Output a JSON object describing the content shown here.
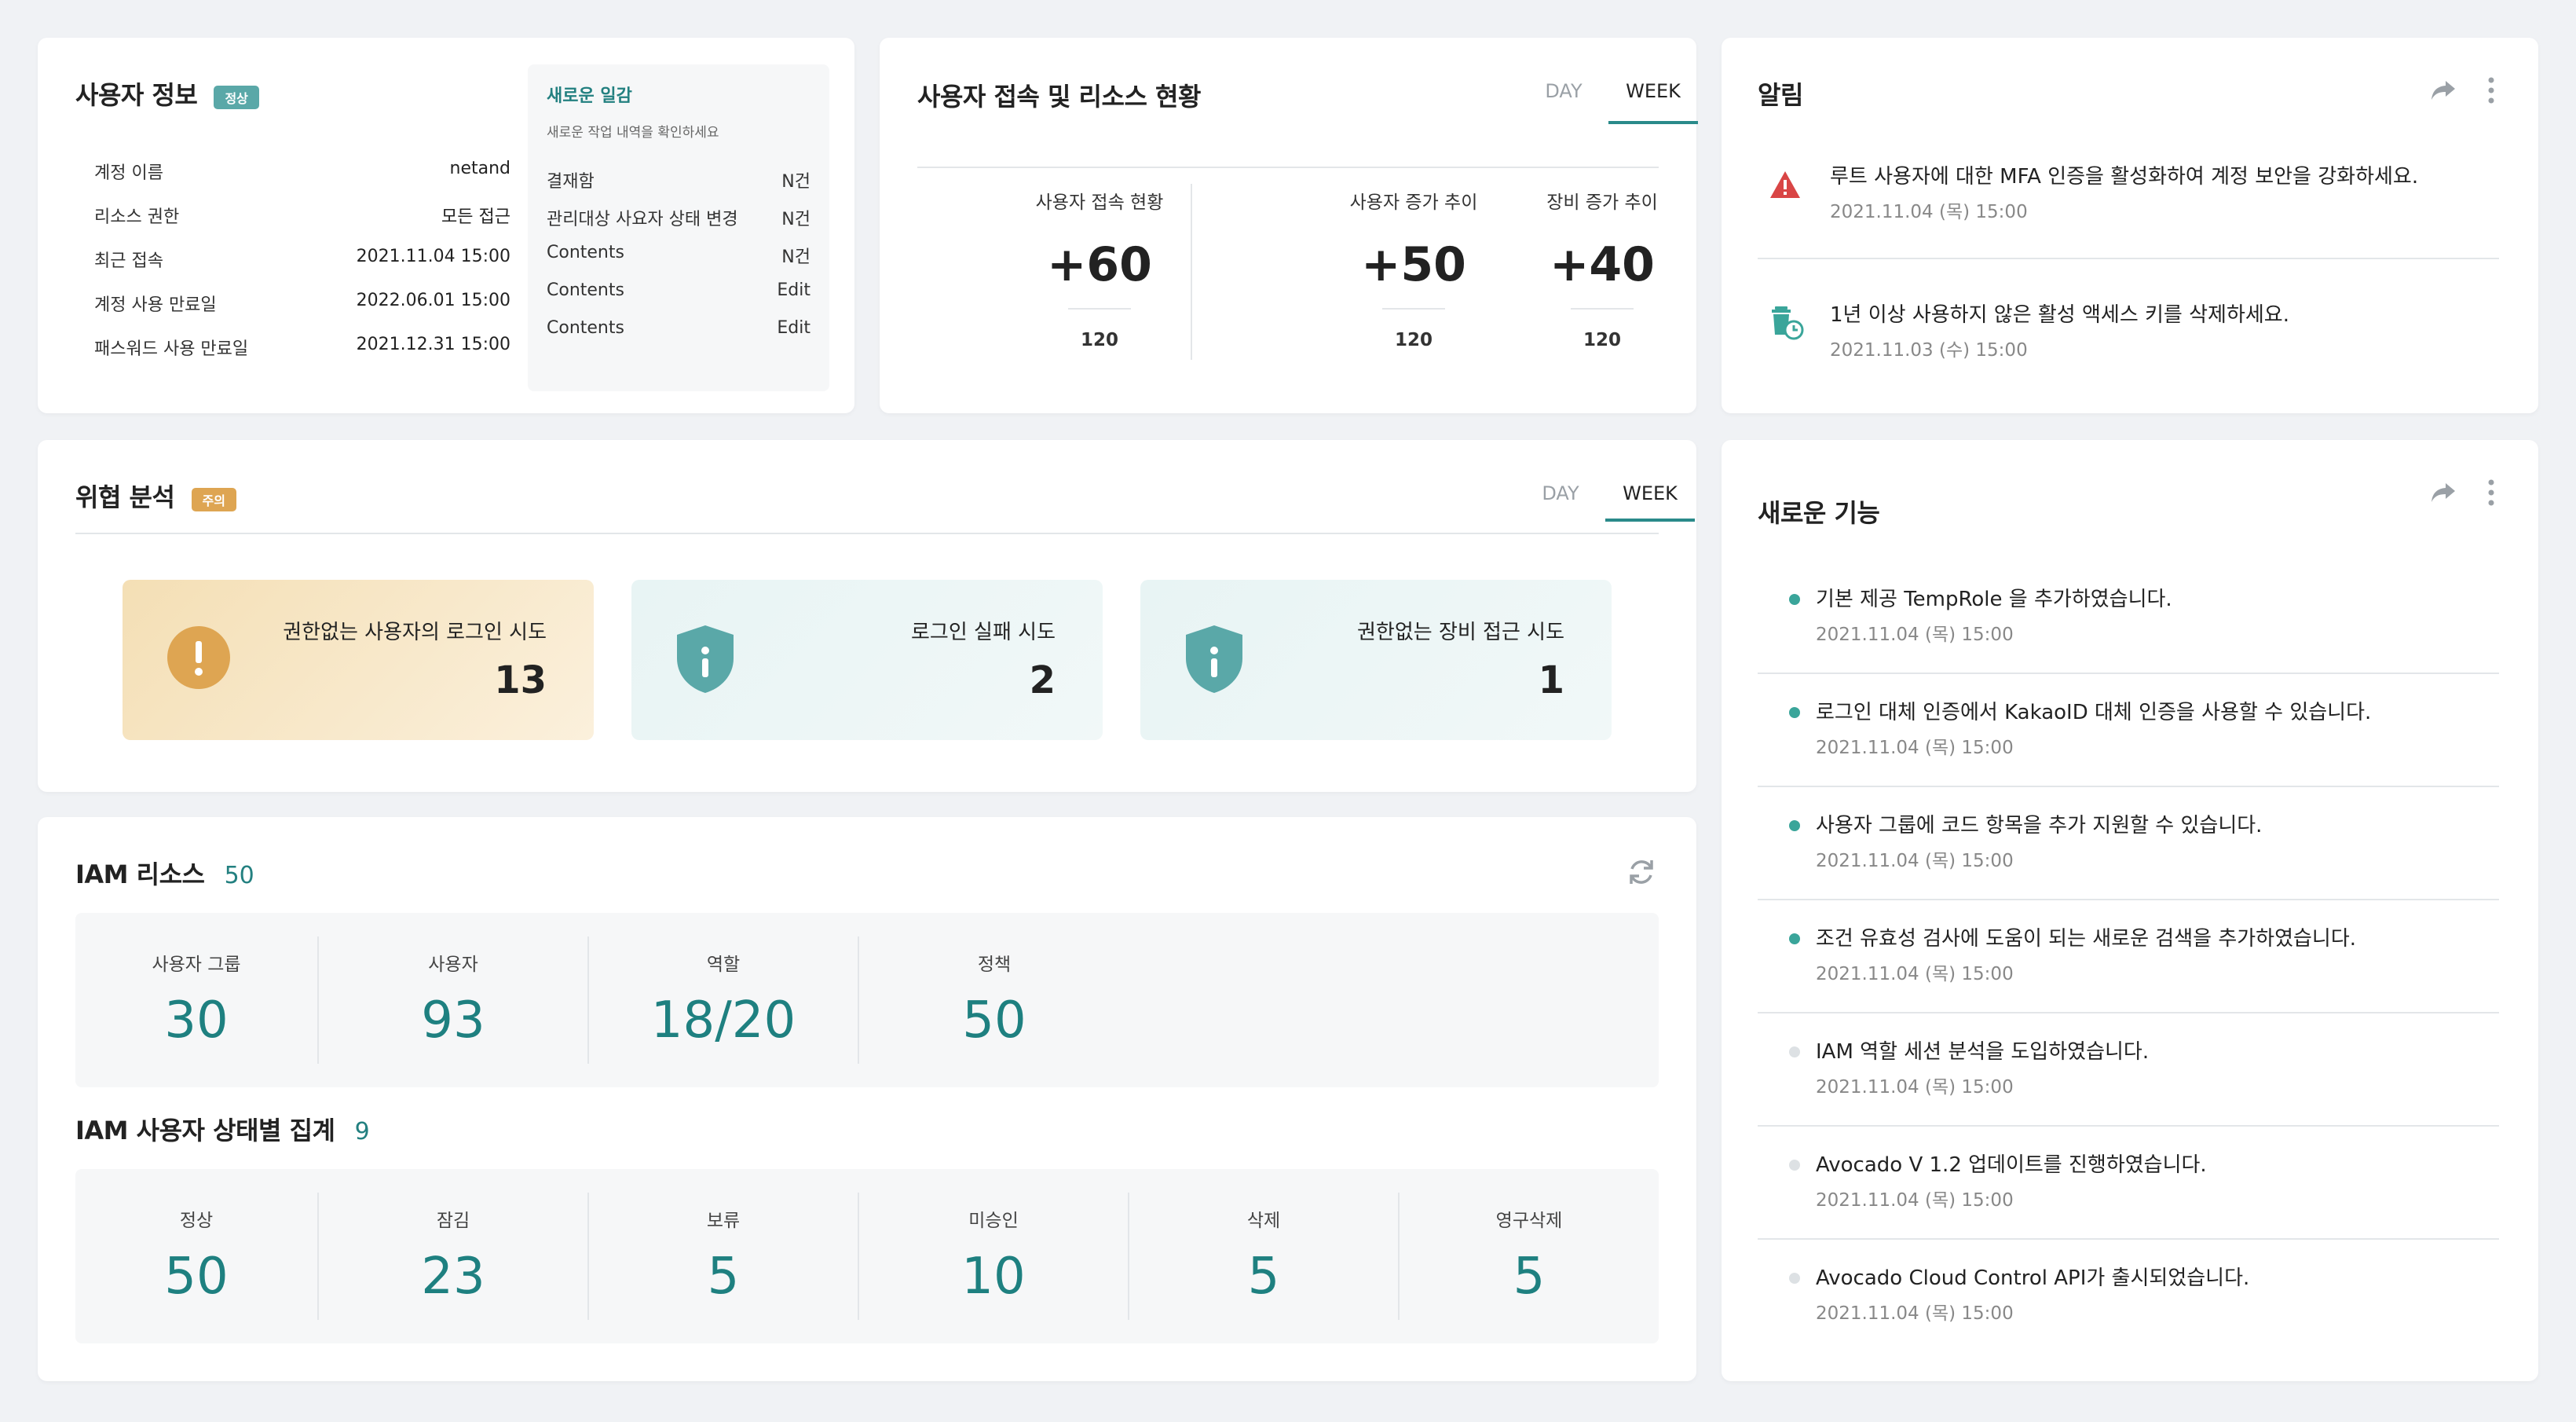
{
  "user_info": {
    "title": "사용자 정보",
    "badge": "정상",
    "rows": [
      {
        "label": "계정 이름",
        "value": "netand"
      },
      {
        "label": "리소스 권한",
        "value": "모든 접근"
      },
      {
        "label": "최근 접속",
        "value": "2021.11.04 15:00"
      },
      {
        "label": "계정 사용 만료일",
        "value": "2022.06.01 15:00"
      },
      {
        "label": "패스워드 사용 만료일",
        "value": "2021.12.31 15:00"
      }
    ],
    "recent": {
      "title": "새로운 일감",
      "subtitle": "새로운 작업 내역을 확인하세요",
      "rows": [
        {
          "label": "결재함",
          "value": "N건"
        },
        {
          "label": "관리대상 사요자 상태 변경",
          "value": "N건"
        },
        {
          "label": "Contents",
          "value": "N건"
        },
        {
          "label": "Contents",
          "value": "Edit"
        },
        {
          "label": "Contents",
          "value": "Edit"
        }
      ]
    }
  },
  "access": {
    "title": "사용자 접속 및 리소스 현황",
    "tabs": [
      "DAY",
      "WEEK"
    ],
    "active_tab": "WEEK",
    "stats": [
      {
        "label": "사용자 접속 현황",
        "value": "+60",
        "sub": "120"
      },
      {
        "label": "사용자 증가 추이",
        "value": "+50",
        "sub": "120"
      },
      {
        "label": "장비 증가 추이",
        "value": "+40",
        "sub": "120"
      }
    ]
  },
  "alerts": {
    "title": "알림",
    "items": [
      {
        "text": "루트 사용자에 대한 MFA 인증을 활성화하여 계정 보안을 강화하세요.",
        "date": "2021.11.04 (목) 15:00",
        "icon": "warning-triangle-icon"
      },
      {
        "text": "1년 이상 사용하지 않은 활성 액세스 키를 삭제하세요.",
        "date": "2021.11.03 (수) 15:00",
        "icon": "trash-clock-icon"
      }
    ]
  },
  "threat": {
    "title": "위협 분석",
    "badge": "주의",
    "tabs": [
      "DAY",
      "WEEK"
    ],
    "active_tab": "WEEK",
    "cards": [
      {
        "label": "권한없는 사용자의 로그인 시도",
        "value": "13",
        "icon": "exclamation-circle-icon"
      },
      {
        "label": "로그인 실패 시도",
        "value": "2",
        "icon": "shield-info-icon"
      },
      {
        "label": "권한없는 장비 접근 시도",
        "value": "1",
        "icon": "shield-info-icon"
      }
    ]
  },
  "iam_resource": {
    "title": "IAM 리소스",
    "count": "50",
    "items": [
      {
        "label": "사용자 그룹",
        "value": "30"
      },
      {
        "label": "사용자",
        "value": "93"
      },
      {
        "label": "역할",
        "value": "18/20"
      },
      {
        "label": "정책",
        "value": "50"
      }
    ]
  },
  "iam_status": {
    "title": "IAM 사용자 상태별 집계",
    "count": "9",
    "items": [
      {
        "label": "정상",
        "value": "50"
      },
      {
        "label": "잠김",
        "value": "23"
      },
      {
        "label": "보류",
        "value": "5"
      },
      {
        "label": "미승인",
        "value": "10"
      },
      {
        "label": "삭제",
        "value": "5"
      },
      {
        "label": "영구삭제",
        "value": "5"
      }
    ]
  },
  "features": {
    "title": "새로운 기능",
    "items": [
      {
        "text": "기본 제공 TempRole 을 추가하였습니다.",
        "date": "2021.11.04 (목) 15:00",
        "unread": true
      },
      {
        "text": "로그인 대체 인증에서 KakaoID 대체 인증을 사용할 수 있습니다.",
        "date": "2021.11.04 (목) 15:00",
        "unread": true
      },
      {
        "text": "사용자 그룹에 코드 항목을 추가 지원할 수 있습니다.",
        "date": "2021.11.04 (목) 15:00",
        "unread": true
      },
      {
        "text": "조건 유효성 검사에 도움이 되는 새로운 검색을 추가하였습니다.",
        "date": "2021.11.04 (목) 15:00",
        "unread": true
      },
      {
        "text": "IAM 역할 세션 분석을 도입하였습니다.",
        "date": "2021.11.04 (목) 15:00",
        "unread": false
      },
      {
        "text": "Avocado V 1.2 업데이트를 진행하였습니다.",
        "date": "2021.11.04 (목) 15:00",
        "unread": false
      },
      {
        "text": "Avocado Cloud Control API가 출시되었습니다.",
        "date": "2021.11.04 (목) 15:00",
        "unread": false
      }
    ]
  },
  "colors": {
    "accent": "#2a8a8a",
    "ok_badge": "#5aa8a8",
    "warn_badge": "#dea552",
    "danger": "#d94545",
    "unread_dot": "#3aa59a",
    "read_dot": "#dde1e4"
  }
}
